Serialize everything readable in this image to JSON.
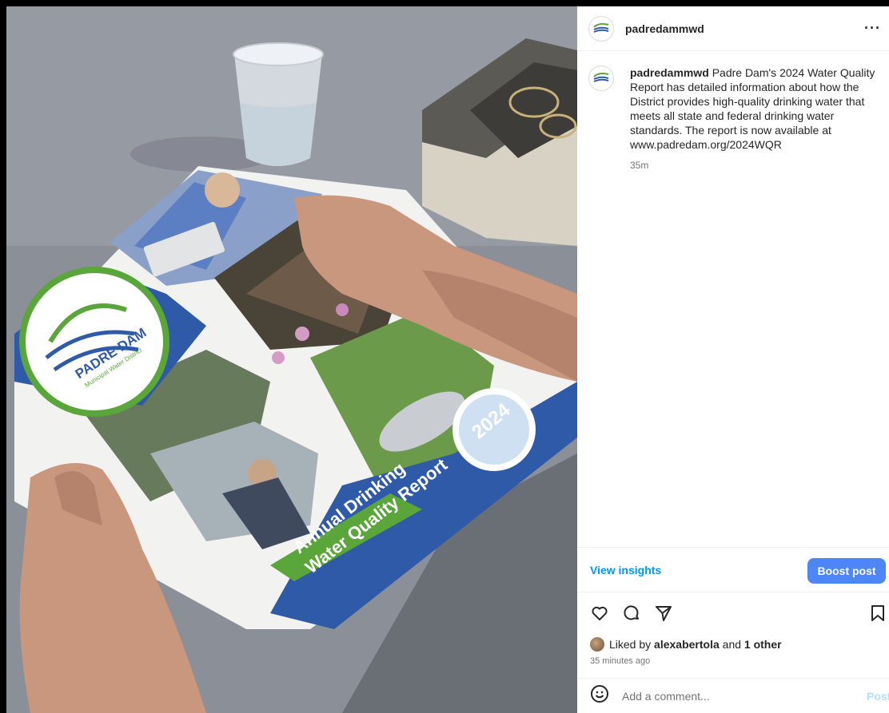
{
  "post": {
    "username": "padredammwd",
    "caption": "Padre Dam's 2024 Water Quality Report has detailed information about how the District provides high-quality drinking water that meets all state and federal drinking water standards. The report is now available at www.padredam.org/2024WQR",
    "caption_age": "35m",
    "avatar_icon": "padre-dam-logo-icon",
    "more_icon": "more-options-icon"
  },
  "photo": {
    "cover_brand": "PADRE DAM",
    "cover_brand_sub": "Municipal Water District",
    "cover_year": "2024",
    "cover_title_line1": "Annual Drinking",
    "cover_title_line2": "Water Quality Report",
    "colors": {
      "cover_blue": "#2f5aa8",
      "cover_green": "#5aa63b",
      "table_gray": "#8b8f98"
    }
  },
  "insights": {
    "view_label": "View insights",
    "boost_label": "Boost post"
  },
  "actions": {
    "icons": [
      "heart-icon",
      "comment-icon",
      "share-icon",
      "bookmark-icon"
    ]
  },
  "likes": {
    "prefix": "Liked by",
    "user": "alexabertola",
    "conjunction": "and",
    "others": "1 other",
    "time": "35 minutes ago"
  },
  "comment": {
    "placeholder": "Add a comment...",
    "post_label": "Post"
  },
  "colors": {
    "accent_link": "#0095f6",
    "boost_button": "#4f86f7",
    "post_disabled": "#b2dffc"
  }
}
